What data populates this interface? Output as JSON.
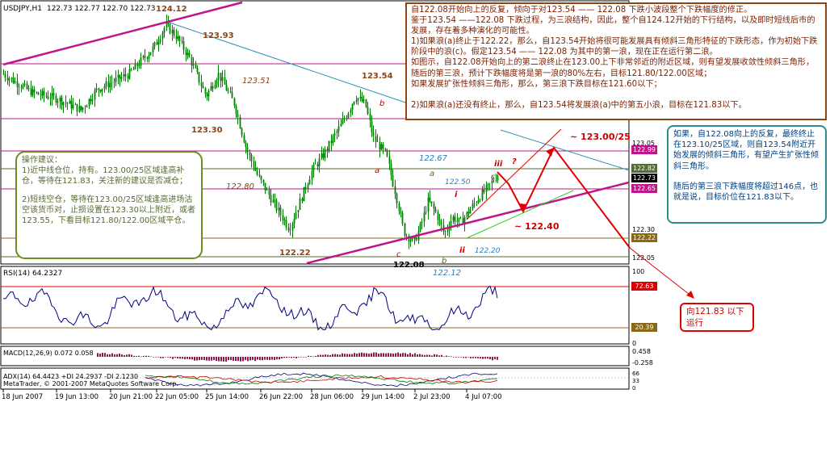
{
  "header": {
    "symbol": "USDJPY,H1",
    "ohlc": "122.73 122.77 122.70 122.73"
  },
  "chart_data": {
    "type": "candlestick",
    "title": "USDJPY,H1 122.73 122.77 122.70 122.73",
    "ylim": [
      121.95,
      124.2
    ],
    "y_ticks": [
      "123.05",
      "122.30",
      "122.05"
    ],
    "x_ticks": [
      "18 Jun 2007",
      "19 Jun 13:00",
      "20 Jun 21:00",
      "22 Jun 05:00",
      "25 Jun 14:00",
      "26 Jun 22:00",
      "28 Jun 06:00",
      "29 Jun 14:00",
      "2 Jul 23:00",
      "4 Jul 07:00"
    ],
    "price_tags": [
      {
        "value": "122.99",
        "color": "#ffffff"
      },
      {
        "value": "122.82",
        "color": "#ffffff"
      },
      {
        "value": "122.73",
        "color": "#ffffff"
      },
      {
        "value": "122.65",
        "color": "#ffffff"
      },
      {
        "value": "122.22",
        "color": "#ffffff"
      }
    ],
    "horizontal_levels": [
      124.12,
      123.93,
      123.3,
      122.99,
      122.82,
      122.65,
      122.22,
      122.08
    ],
    "price_labels": [
      {
        "text": "124.12",
        "x": "22 Jun",
        "y": 124.12
      },
      {
        "text": "123.93",
        "x": "24 Jun",
        "y": 123.93
      },
      {
        "text": "123.51",
        "x": "25 Jun",
        "y": 123.51
      },
      {
        "text": "123.30",
        "x": "22 Jun",
        "y": 123.3
      },
      {
        "text": "123.54",
        "x": "29 Jun",
        "y": 123.54
      },
      {
        "text": "122.80",
        "x": "26 Jun",
        "y": 122.8
      },
      {
        "text": "122.22",
        "x": "27 Jun",
        "y": 122.22
      },
      {
        "text": "122.08",
        "x": "2 Jul",
        "y": 122.08
      },
      {
        "text": "122.67",
        "x": "3 Jul",
        "y": 122.67
      },
      {
        "text": "122.50",
        "x": "3 Jul",
        "y": 122.5
      },
      {
        "text": "122.20",
        "x": "3 Jul",
        "y": 122.2
      },
      {
        "text": "122.12",
        "x": "3 Jul",
        "y": 122.12
      }
    ],
    "wave_labels": [
      "a",
      "b",
      "c",
      "a",
      "b",
      "c",
      "i",
      "ii",
      "iii",
      "?"
    ],
    "projections": [
      {
        "text": "~ 123.00/25",
        "value": "123.00/25"
      },
      {
        "text": "~ 122.40",
        "value": "122.40"
      }
    ],
    "rsi": {
      "label": "RSI(14) 64.2327",
      "levels": [
        "100",
        "72.63",
        "20.39",
        "0"
      ]
    },
    "macd": {
      "label": "MACD(12,26,9) 0.072 0.058",
      "levels": [
        "0.458",
        "-0.258"
      ]
    },
    "adx": {
      "label": "ADX(14) 64.4423 +DI 24.2937 -DI 2.1230",
      "levels": [
        "66",
        "33",
        "0"
      ]
    },
    "copyright": "MetaTrader, © 2001-2007 MetaQuotes Software Corp."
  },
  "notes": {
    "top": [
      "自122.08开始向上的反复，倾向于对123.54 —— 122.08 下跌小波段整个下跌幅度的修正。",
      "鉴于123.54 ——122.08 下跌过程，为三浪结构，因此，整个自124.12开始的下行结构，以及即时短线后市的发展，存在着多种演化的可能性。",
      "1)如果浪(a)终止于122.22，那么，自123.54开始将很可能发展具有倾斜三角形特征的下跌形态，作为初始下跌阶段中的浪(c)。假定123.54 —— 122.08 为其中的第一浪，现在正在运行第二浪。",
      "如图示，自122.08开始向上的第二浪终止在123.00上下非常邻近的附近区域，则有望发展收敛性倾斜三角形，随后的第三浪，预计下跌幅度将是第一浪的80%左右，目标121.80/122.00区域；",
      "如果发展扩张性倾斜三角形，那么，第三浪下跌目标在121.60以下；",
      "",
      "2)如果浪(a)还没有终止，那么，自123.54将发展浪(a)中的第五小浪，目标在121.83以下。"
    ],
    "right": [
      "如果，自122.08向上的反复，最终终止在123.10/25区域，则自123.54附近开始发展的倾斜三角形，有望产生扩张性倾斜三角形。",
      "",
      "随后的第三浪下跌幅度将超过146点，也就是说，目标价位在121.83以下。"
    ],
    "left": [
      "操作建议：",
      "1)近中线仓位，持有。123.00/25区域逢高补仓，等待在121.83，关注新的建议是否减仓；",
      "",
      "2)短线空仓，等待在123.00/25区域逢高进场沽空该货币对，止损设置在123.30以上附近，或者123.55，下看目标121.80/122.00区域平仓。"
    ],
    "red": "向121.83 以下运行"
  },
  "colors": {
    "bull": "#008000",
    "purple": "#c0158a",
    "teal": "#2b8fb3",
    "red": "#e00000",
    "label_brown": "#8b4513",
    "blue_label": "#2f7fb5"
  }
}
